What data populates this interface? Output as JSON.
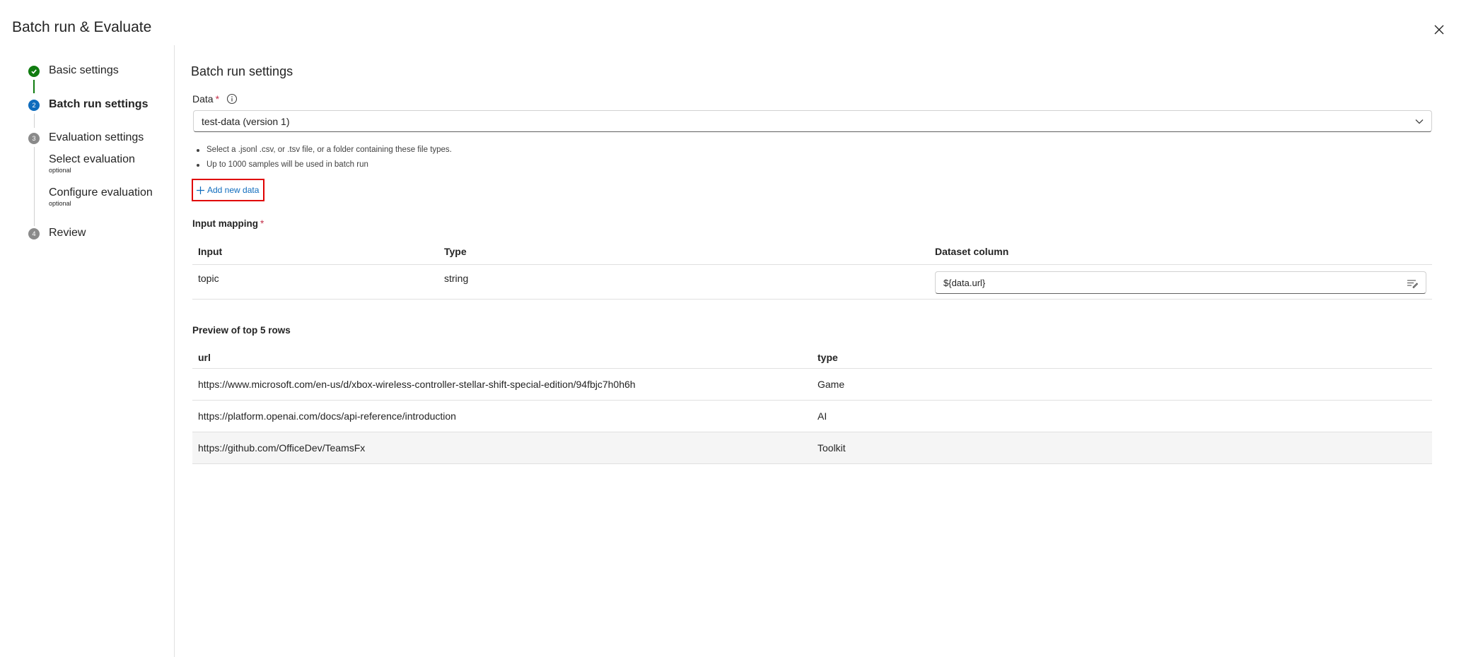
{
  "header": {
    "title": "Batch run & Evaluate"
  },
  "stepper": {
    "steps": [
      {
        "label": "Basic settings",
        "state": "complete"
      },
      {
        "label": "Batch run settings",
        "number": "2",
        "state": "current"
      },
      {
        "label": "Evaluation settings",
        "number": "3",
        "state": "pending"
      },
      {
        "label": "Review",
        "number": "4",
        "state": "pending"
      }
    ],
    "sub_steps": [
      {
        "label": "Select evaluation",
        "note": "optional"
      },
      {
        "label": "Configure evaluation",
        "note": "optional"
      }
    ]
  },
  "main": {
    "section_title": "Batch run settings",
    "data_field": {
      "label": "Data",
      "required_mark": "*",
      "value": "test-data (version 1)",
      "hints": [
        "Select a .jsonl .csv, or .tsv file, or a folder containing these file types.",
        "Up to 1000 samples will be used in batch run"
      ],
      "add_label": "Add new data"
    },
    "input_mapping": {
      "label": "Input mapping",
      "required_mark": "*",
      "headers": [
        "Input",
        "Type",
        "Dataset column"
      ],
      "rows": [
        {
          "input": "topic",
          "type": "string",
          "column": "${data.url}"
        }
      ]
    },
    "preview": {
      "label": "Preview of top 5 rows",
      "headers": [
        "url",
        "type"
      ],
      "rows": [
        {
          "url": "https://www.microsoft.com/en-us/d/xbox-wireless-controller-stellar-shift-special-edition/94fbjc7h0h6h",
          "type": "Game"
        },
        {
          "url": "https://platform.openai.com/docs/api-reference/introduction",
          "type": "AI"
        },
        {
          "url": "https://github.com/OfficeDev/TeamsFx",
          "type": "Toolkit"
        }
      ]
    }
  },
  "colors": {
    "complete": "#107c10",
    "current": "#0f6cbd",
    "pending": "#8a8a8a",
    "link": "#0f6cbd",
    "highlight_box": "#e00000",
    "required": "#c4314b"
  },
  "icons": {
    "close": "close-icon",
    "complete": "checkmark-circle-icon",
    "info": "info-icon",
    "dropdown": "chevron-down-icon",
    "add": "plus-icon",
    "column_picker": "text-edit-icon"
  }
}
